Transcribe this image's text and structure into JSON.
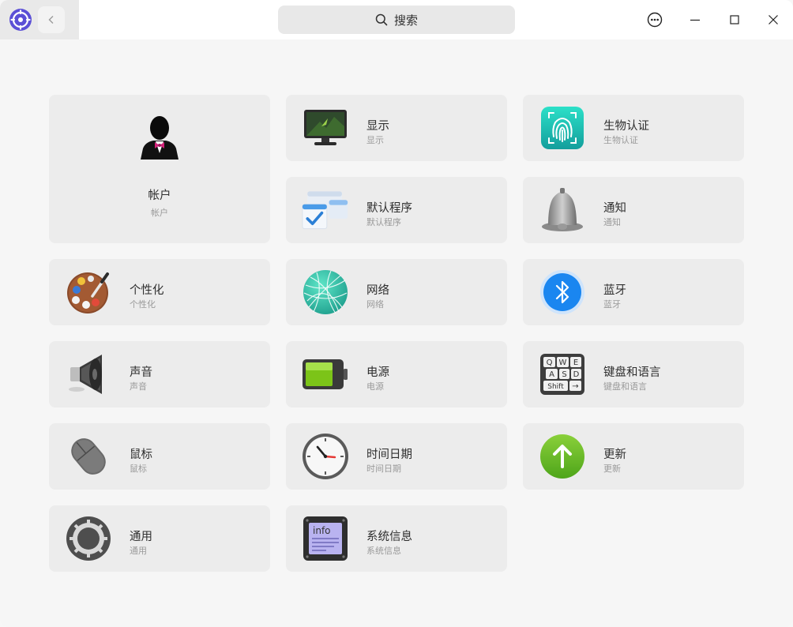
{
  "search": {
    "label": "搜索"
  },
  "modules": {
    "account": {
      "title": "帐户",
      "subtitle": "帐户"
    },
    "display": {
      "title": "显示",
      "subtitle": "显示"
    },
    "biometric": {
      "title": "生物认证",
      "subtitle": "生物认证"
    },
    "default_apps": {
      "title": "默认程序",
      "subtitle": "默认程序"
    },
    "notification": {
      "title": "通知",
      "subtitle": "通知"
    },
    "personalize": {
      "title": "个性化",
      "subtitle": "个性化"
    },
    "network": {
      "title": "网络",
      "subtitle": "网络"
    },
    "bluetooth": {
      "title": "蓝牙",
      "subtitle": "蓝牙"
    },
    "sound": {
      "title": "声音",
      "subtitle": "声音"
    },
    "power": {
      "title": "电源",
      "subtitle": "电源"
    },
    "keyboard": {
      "title": "键盘和语言",
      "subtitle": "键盘和语言"
    },
    "mouse": {
      "title": "鼠标",
      "subtitle": "鼠标"
    },
    "datetime": {
      "title": "时间日期",
      "subtitle": "时间日期"
    },
    "update": {
      "title": "更新",
      "subtitle": "更新"
    },
    "general": {
      "title": "通用",
      "subtitle": "通用"
    },
    "sysinfo": {
      "title": "系统信息",
      "subtitle": "系统信息"
    }
  },
  "icon_text": {
    "keyboard_keys": [
      "Q",
      "W",
      "E",
      "A",
      "S",
      "D",
      "Shift",
      "→"
    ],
    "info_label": "info"
  },
  "colors": {
    "window_bg": "#f6f6f6",
    "card_bg": "#ececec",
    "titlebar_bg": "#ffffff",
    "title_text": "#2e2e2e",
    "subtitle_text": "#9a9a9a"
  }
}
